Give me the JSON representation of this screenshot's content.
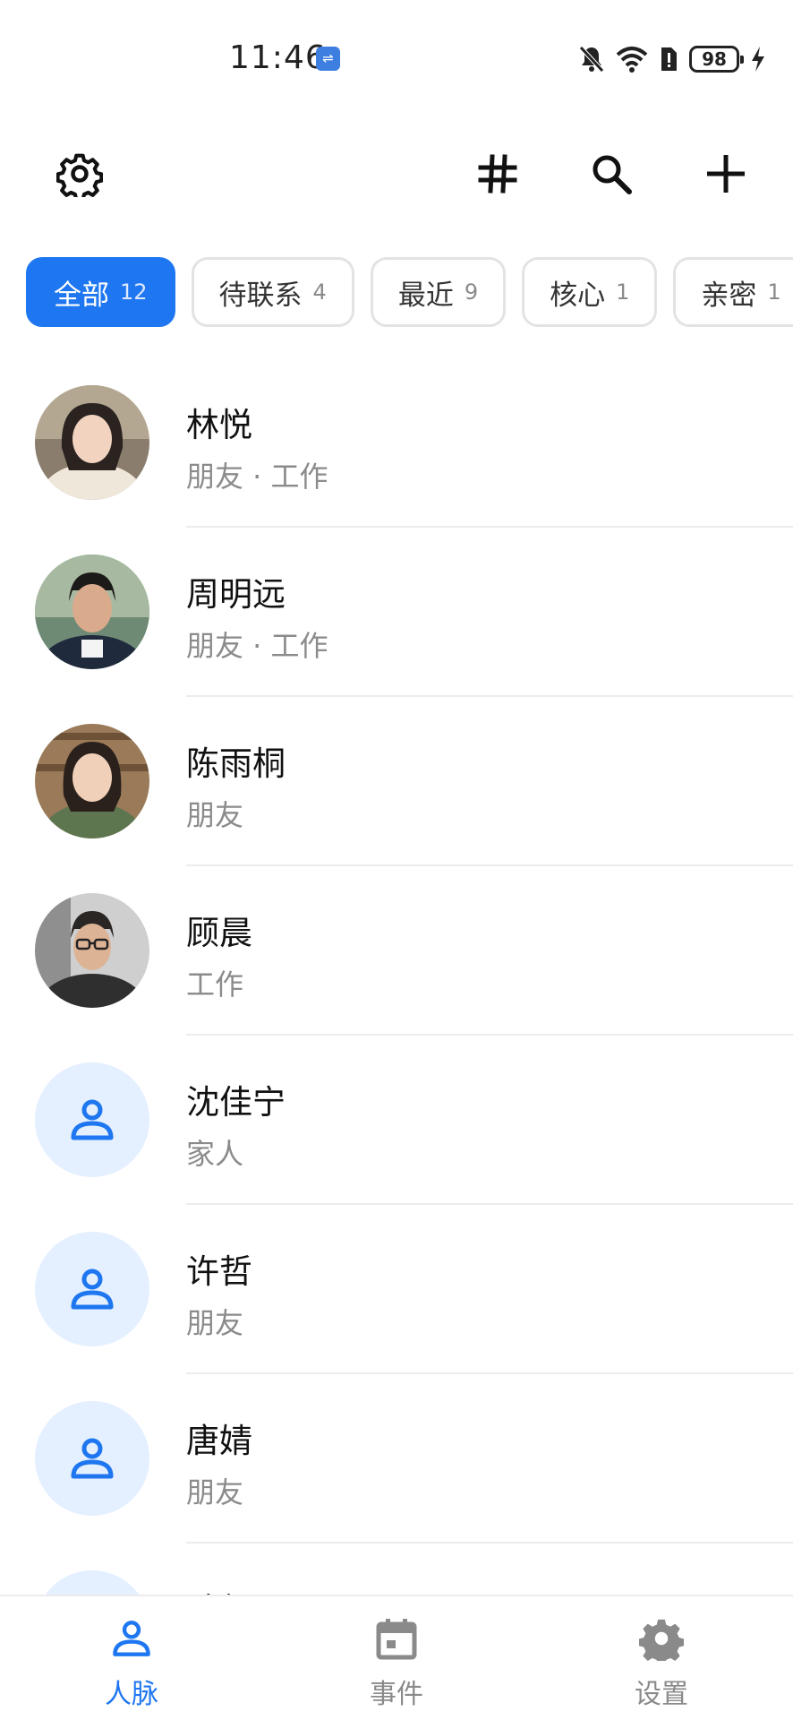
{
  "status": {
    "time": "11:46",
    "battery": "98",
    "icons": [
      "usb-icon",
      "mute-bell-icon",
      "wifi-icon",
      "sim-alert-icon",
      "battery-icon",
      "charging-bolt-icon"
    ]
  },
  "toolbar": {
    "icons": [
      "gear-icon",
      "hashtag-icon",
      "search-icon",
      "plus-icon"
    ]
  },
  "chips": [
    {
      "label": "全部",
      "count": "12",
      "active": true
    },
    {
      "label": "待联系",
      "count": "4",
      "active": false
    },
    {
      "label": "最近",
      "count": "9",
      "active": false
    },
    {
      "label": "核心",
      "count": "1",
      "active": false
    },
    {
      "label": "亲密",
      "count": "1",
      "active": false
    }
  ],
  "contacts": [
    {
      "name": "林悦",
      "tags": "朋友 · 工作",
      "avatar": "photo-woman-cafe"
    },
    {
      "name": "周明远",
      "tags": "朋友 · 工作",
      "avatar": "photo-man-park"
    },
    {
      "name": "陈雨桐",
      "tags": "朋友",
      "avatar": "photo-woman-bookshelf"
    },
    {
      "name": "顾晨",
      "tags": "工作",
      "avatar": "photo-man-glasses-office"
    },
    {
      "name": "沈佳宁",
      "tags": "家人",
      "avatar": "person-placeholder-icon"
    },
    {
      "name": "许哲",
      "tags": "朋友",
      "avatar": "person-placeholder-icon"
    },
    {
      "name": "唐婧",
      "tags": "朋友",
      "avatar": "person-placeholder-icon"
    },
    {
      "name": "陆凯",
      "tags": "",
      "avatar": "person-placeholder-icon"
    }
  ],
  "nav": [
    {
      "label": "人脉",
      "icon": "person-icon",
      "active": true
    },
    {
      "label": "事件",
      "icon": "calendar-icon",
      "active": false
    },
    {
      "label": "设置",
      "icon": "gear-icon",
      "active": false
    }
  ],
  "colors": {
    "accent": "#1e77f0",
    "placeholder_bg": "#e4efff",
    "secondary_text": "#8b8b8b"
  }
}
